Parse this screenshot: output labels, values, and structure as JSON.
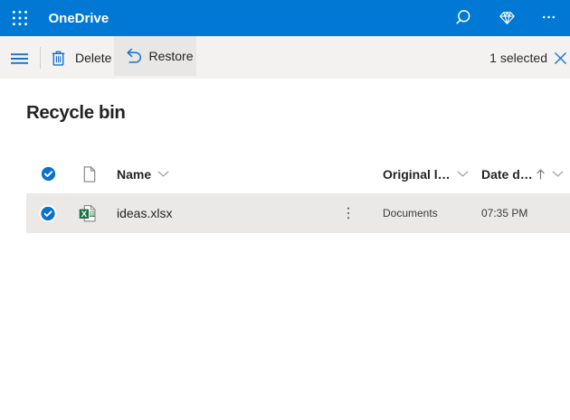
{
  "topbar": {
    "title": "OneDrive",
    "brand_color": "#0078d4",
    "icons": [
      "app-launcher",
      "search",
      "premium-diamond",
      "more-options"
    ]
  },
  "commandbar": {
    "buttons": [
      {
        "label": "Delete",
        "icon": "delete-trash"
      },
      {
        "label": "Restore",
        "icon": "restore-arrow",
        "active": true
      }
    ],
    "selection_status": "1 selected",
    "clear_selection_icon": "close-x",
    "menu_icon": "hamburger"
  },
  "page": {
    "title": "Recycle bin"
  },
  "table": {
    "columns": [
      {
        "label": "Name",
        "icon": "chevron-down"
      },
      {
        "label": "Original l…",
        "icon": "chevron-down"
      },
      {
        "label": "Date d…",
        "sort": "ascending",
        "icons": [
          "arrow-up",
          "chevron-down"
        ]
      }
    ],
    "rows": [
      {
        "selected": true,
        "file_icon": "excel-file",
        "name": "ideas.xlsx",
        "actions_icon": "vertical-ellipsis",
        "original_location": "Documents",
        "date_deleted": "07:35 PM"
      }
    ]
  },
  "colors": {
    "suite_bar": "#0078d4",
    "command_bar_bg": "#f3f2f1",
    "active_button_bg": "#e8e6e4",
    "selected_row_bg": "#ebe9e7",
    "icon_blue": "#1672cd",
    "check_circle_blue": "#0c71cb",
    "excel_green": "#1e7145",
    "text_dark": "#252423"
  }
}
